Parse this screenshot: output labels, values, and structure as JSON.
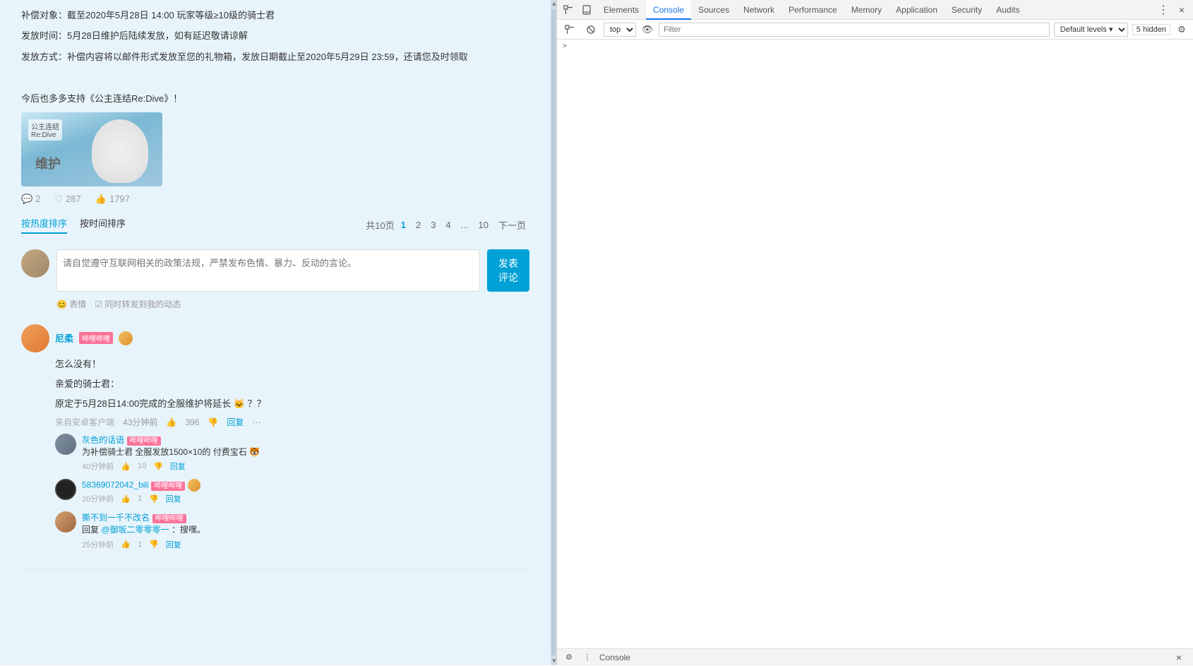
{
  "content": {
    "post": {
      "line1": "补偿对象：截至2020年5月28日 14:00 玩家等级≥10级的骑士君",
      "line2": "发放时间：5月28日维护后陆续发放，如有延迟敬请谅解",
      "line3": "发放方式：补偿内容将以邮件形式发放至您的礼物箱，发放日期截止至2020年5月29日 23:59，还请您及时领取",
      "blank_line": "",
      "promo_text": "今后也多多支持《公主连结Re:Dive》！",
      "action_comment_count": "2",
      "action_like_count": "287",
      "action_share_count": "1797"
    },
    "sort_tabs": {
      "hot": "按热度排序",
      "time": "按时间排序"
    },
    "pagination": {
      "total_text": "共10页",
      "pages": [
        "1",
        "2",
        "3",
        "4",
        "...",
        "10",
        "下一页"
      ]
    },
    "comment_input": {
      "placeholder": "请自觉遵守互联网相关的政策法规，严禁发布色情、暴力、反动的言论。",
      "emoji_label": "表情",
      "sync_label": "同时转发到我的动态",
      "submit_label": "发表\n评论"
    },
    "comments": [
      {
        "username": "尼柔",
        "badges": [
          "哔哩哔哩"
        ],
        "fan_badge": true,
        "content_line1": "怎么没有！",
        "content_line2": "亲爱的骑士君：",
        "content_line3": "原定于5月28日14:00完成的全服维护将延长",
        "emoji": "🐱??",
        "source": "来自安卓客户端",
        "time": "43分钟前",
        "likes": "396",
        "sub_comments": [
          {
            "username": "灰色的话语",
            "badge": "哔哩哔哩",
            "text": "为补偿骑士君 全服发放1500×10的 付费宝石",
            "emoji": "🐯",
            "time": "40分钟前",
            "likes": "10"
          },
          {
            "username": "58369072042_bili",
            "badge": "哔哩哔哩",
            "fan_icon": true,
            "text": "",
            "time": "20分钟前",
            "likes": "1"
          },
          {
            "username": "撕不到一千不改名",
            "badge": "哔哩哔哩",
            "reply_to": "@御坂二零零零一",
            "text": "：搜嘿。",
            "time": "25分钟前",
            "likes": "1"
          }
        ]
      }
    ]
  },
  "devtools": {
    "toolbar_icons": {
      "inspect": "⬚",
      "device": "⬜",
      "settings": "⚙",
      "dots": "⋮",
      "close": "×"
    },
    "tabs": [
      "Elements",
      "Console",
      "Sources",
      "Network",
      "Performance",
      "Memory",
      "Application",
      "Security",
      "Audits"
    ],
    "active_tab": "Console",
    "console": {
      "context_label": "top",
      "filter_placeholder": "Filter",
      "level_label": "Default levels",
      "hidden_count": "5 hidden",
      "arrow_label": ">"
    },
    "bottom_bar": {
      "settings_icon": "⚙",
      "label": "Console"
    }
  }
}
